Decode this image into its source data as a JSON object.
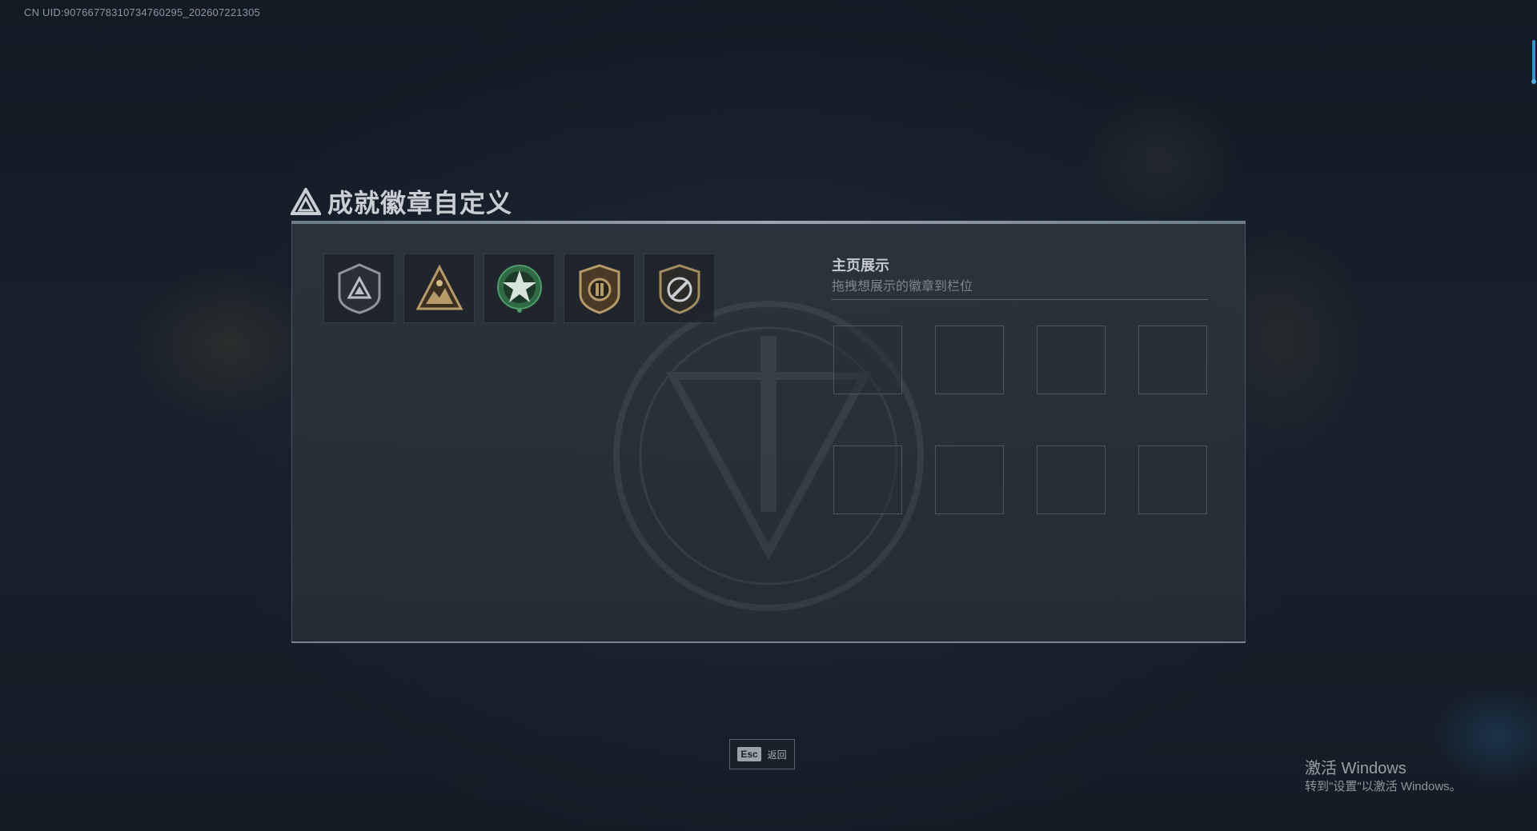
{
  "header": {
    "uid_text": "CN UID:9076677831073476029​5_202607221305"
  },
  "title": {
    "text": "成就徽章自定义",
    "icon": "triangle-emblem-icon"
  },
  "badges": [
    {
      "name": "shield-triangle-badge"
    },
    {
      "name": "mountain-squad-badge"
    },
    {
      "name": "green-star-badge"
    },
    {
      "name": "ammo-shield-badge"
    },
    {
      "name": "no-target-badge"
    }
  ],
  "showcase": {
    "title": "主页展示",
    "subtitle": "拖拽想展示的徽章到栏位",
    "slot_count": 8
  },
  "footer": {
    "esc_key": "Esc",
    "esc_label": "返回"
  },
  "windows_watermark": {
    "title": "激活 Windows",
    "subtitle": "转到\"设置\"以激活 Windows。"
  },
  "colors": {
    "accent_blue": "#3a93c8",
    "badge_gold": "#b59a6a",
    "badge_green": "#3f8a5a"
  }
}
